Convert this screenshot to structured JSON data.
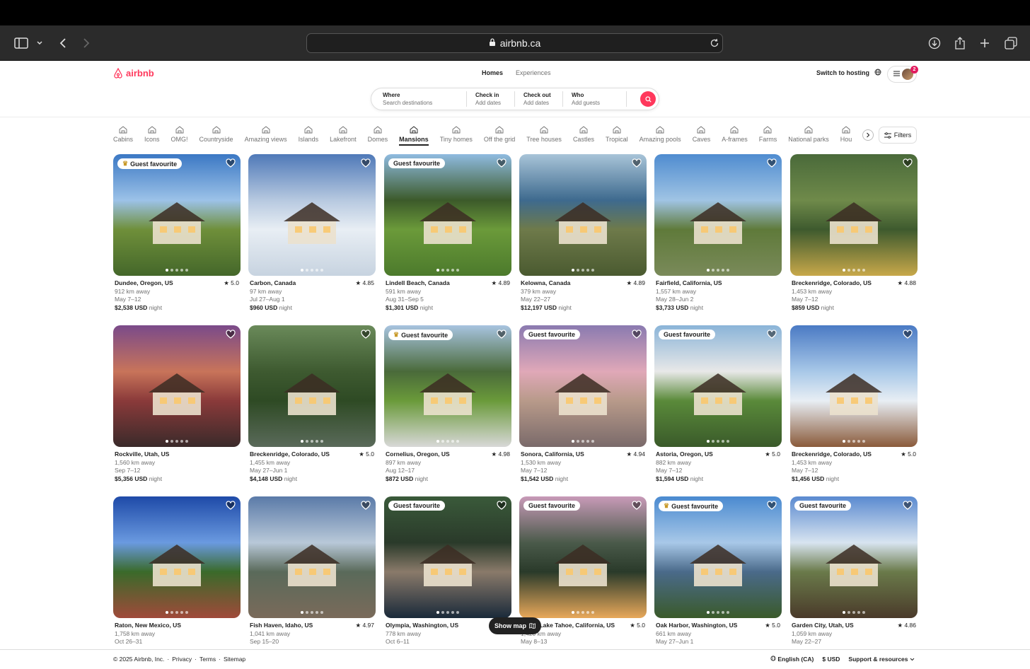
{
  "browser": {
    "url": "airbnb.ca"
  },
  "header": {
    "logo_text": "airbnb",
    "tabs": [
      {
        "label": "Homes",
        "active": true
      },
      {
        "label": "Experiences",
        "active": false
      }
    ],
    "switch_host": "Switch to hosting",
    "notification_count": "2"
  },
  "search": {
    "where_label": "Where",
    "where_value": "Search destinations",
    "checkin_label": "Check in",
    "checkin_value": "Add dates",
    "checkout_label": "Check out",
    "checkout_value": "Add dates",
    "who_label": "Who",
    "who_value": "Add guests"
  },
  "categories": [
    {
      "label": "Cabins",
      "icon": "cabin-icon"
    },
    {
      "label": "Icons",
      "icon": "icons-icon"
    },
    {
      "label": "OMG!",
      "icon": "omg-icon"
    },
    {
      "label": "Countryside",
      "icon": "countryside-icon"
    },
    {
      "label": "Amazing views",
      "icon": "views-icon"
    },
    {
      "label": "Islands",
      "icon": "islands-icon"
    },
    {
      "label": "Lakefront",
      "icon": "lakefront-icon"
    },
    {
      "label": "Domes",
      "icon": "domes-icon"
    },
    {
      "label": "Mansions",
      "icon": "mansions-icon",
      "active": true
    },
    {
      "label": "Tiny homes",
      "icon": "tiny-homes-icon"
    },
    {
      "label": "Off the grid",
      "icon": "off-grid-icon"
    },
    {
      "label": "Tree houses",
      "icon": "tree-houses-icon"
    },
    {
      "label": "Castles",
      "icon": "castles-icon"
    },
    {
      "label": "Tropical",
      "icon": "tropical-icon"
    },
    {
      "label": "Amazing pools",
      "icon": "pools-icon"
    },
    {
      "label": "Caves",
      "icon": "caves-icon"
    },
    {
      "label": "A-frames",
      "icon": "a-frames-icon"
    },
    {
      "label": "Farms",
      "icon": "farms-icon"
    },
    {
      "label": "National parks",
      "icon": "national-parks-icon"
    },
    {
      "label": "Hou",
      "icon": "houseboats-icon"
    }
  ],
  "filters_label": "Filters",
  "price_suffix": "night",
  "listings": [
    {
      "location": "Dundee, Oregon, US",
      "rating": "★ 5.0",
      "distance": "912 km away",
      "dates": "May 7–12",
      "price": "$2,538 USD",
      "badge": "Guest favourite",
      "trophy": true,
      "palette": [
        "#3b78c4",
        "#9cc2e8",
        "#6f8f3a",
        "#44672a"
      ]
    },
    {
      "location": "Carbon, Canada",
      "rating": "★ 4.85",
      "distance": "97 km away",
      "dates": "Jul 27–Aug 1",
      "price": "$960 USD",
      "badge": "",
      "trophy": false,
      "palette": [
        "#4f79b8",
        "#b7c9e0",
        "#e8eef4",
        "#c7d3e0"
      ]
    },
    {
      "location": "Lindell Beach, Canada",
      "rating": "★ 4.89",
      "distance": "591 km away",
      "dates": "Aug 31–Sep 5",
      "price": "$1,301 USD",
      "badge": "Guest favourite",
      "trophy": false,
      "palette": [
        "#8fbbe0",
        "#3c5a2a",
        "#6b9a3a",
        "#4c7a2c"
      ]
    },
    {
      "location": "Kelowna, Canada",
      "rating": "★ 4.89",
      "distance": "379 km away",
      "dates": "May 22–27",
      "price": "$12,197 USD",
      "badge": "",
      "trophy": false,
      "palette": [
        "#a8c4d8",
        "#3e6a8e",
        "#6e7a4a",
        "#4a5a30"
      ]
    },
    {
      "location": "Fairfield, California, US",
      "rating": "",
      "distance": "1,557 km away",
      "dates": "May 28–Jun 2",
      "price": "$3,733 USD",
      "badge": "",
      "trophy": false,
      "palette": [
        "#4f8cd0",
        "#a0c4e4",
        "#5f7a3a",
        "#7a8a5a"
      ]
    },
    {
      "location": "Breckenridge, Colorado, US",
      "rating": "★ 4.88",
      "distance": "1,453 km away",
      "dates": "May 7–12",
      "price": "$859 USD",
      "badge": "",
      "trophy": false,
      "palette": [
        "#4a6a3a",
        "#6f8a4a",
        "#3e5a2e",
        "#c8a84a"
      ]
    },
    {
      "location": "Rockville, Utah, US",
      "rating": "",
      "distance": "1,560 km away",
      "dates": "Sep 7–12",
      "price": "$5,356 USD",
      "badge": "",
      "trophy": false,
      "palette": [
        "#7a4a8a",
        "#c8745a",
        "#8a3a3a",
        "#3a2a2a"
      ]
    },
    {
      "location": "Breckenridge, Colorado, US",
      "rating": "★ 5.0",
      "distance": "1,455 km away",
      "dates": "May 27–Jun 1",
      "price": "$4,148 USD",
      "badge": "",
      "trophy": false,
      "palette": [
        "#6a8a5a",
        "#3e5a30",
        "#2e4a24",
        "#5a6a5a"
      ]
    },
    {
      "location": "Cornelius, Oregon, US",
      "rating": "★ 4.98",
      "distance": "897 km away",
      "dates": "Aug 12–17",
      "price": "$872 USD",
      "badge": "Guest favourite",
      "trophy": true,
      "palette": [
        "#a8c4e0",
        "#4a6a3a",
        "#6a9a3a",
        "#d8d8d8"
      ]
    },
    {
      "location": "Sonora, California, US",
      "rating": "★ 4.94",
      "distance": "1,530 km away",
      "dates": "May 7–12",
      "price": "$1,542 USD",
      "badge": "Guest favourite",
      "trophy": false,
      "palette": [
        "#8a7ab0",
        "#e0a8b8",
        "#b89a8a",
        "#7a6a6a"
      ]
    },
    {
      "location": "Astoria, Oregon, US",
      "rating": "★ 5.0",
      "distance": "882 km away",
      "dates": "May 7–12",
      "price": "$1,594 USD",
      "badge": "Guest favourite",
      "trophy": false,
      "palette": [
        "#8ab4d8",
        "#e8e8e8",
        "#5a8a3a",
        "#3a5a2a"
      ]
    },
    {
      "location": "Breckenridge, Colorado, US",
      "rating": "★ 5.0",
      "distance": "1,453 km away",
      "dates": "May 7–12",
      "price": "$1,456 USD",
      "badge": "",
      "trophy": false,
      "palette": [
        "#4a7ac4",
        "#a8c8e8",
        "#e8eef4",
        "#8a5a3a"
      ]
    },
    {
      "location": "Raton, New Mexico, US",
      "rating": "",
      "distance": "1,758 km away",
      "dates": "Oct 26–31",
      "price": "",
      "badge": "",
      "trophy": false,
      "palette": [
        "#1e4aa8",
        "#6a9ae0",
        "#3a6a2a",
        "#a04a3a"
      ]
    },
    {
      "location": "Fish Haven, Idaho, US",
      "rating": "★ 4.97",
      "distance": "1,041 km away",
      "dates": "Sep 15–20",
      "price": "",
      "badge": "",
      "trophy": false,
      "palette": [
        "#5a7aa8",
        "#b8c8d8",
        "#5a6a5a",
        "#7a6a5a"
      ]
    },
    {
      "location": "Olympia, Washington, US",
      "rating": "",
      "distance": "778 km away",
      "dates": "Oct 6–11",
      "price": "",
      "badge": "Guest favourite",
      "trophy": false,
      "palette": [
        "#3a5a3a",
        "#2a3a2a",
        "#8a7a6a",
        "#1a2a3a"
      ]
    },
    {
      "location": "South Lake Tahoe, California, US",
      "rating": "★ 5.0",
      "distance": "1,420 km away",
      "dates": "May 8–13",
      "price": "",
      "badge": "Guest favourite",
      "trophy": false,
      "palette": [
        "#c89ab8",
        "#4a5a4a",
        "#2a3a2a",
        "#e8a85a"
      ]
    },
    {
      "location": "Oak Harbor, Washington, US",
      "rating": "★ 5.0",
      "distance": "661 km away",
      "dates": "May 27–Jun 1",
      "price": "",
      "badge": "Guest favourite",
      "trophy": true,
      "palette": [
        "#4a8ad0",
        "#a8c8e8",
        "#4a6a8a",
        "#3a5a2a"
      ]
    },
    {
      "location": "Garden City, Utah, US",
      "rating": "★ 4.86",
      "distance": "1,059 km away",
      "dates": "May 22–27",
      "price": "",
      "badge": "Guest favourite",
      "trophy": false,
      "palette": [
        "#5a8ad0",
        "#d8e4f0",
        "#6a7a4a",
        "#4a3a2a"
      ]
    }
  ],
  "show_map_label": "Show map",
  "footer": {
    "copyright": "© 2025 Airbnb, Inc.",
    "links": [
      "Privacy",
      "Terms",
      "Sitemap"
    ],
    "language": "English (CA)",
    "currency": "$ USD",
    "support": "Support & resources"
  }
}
